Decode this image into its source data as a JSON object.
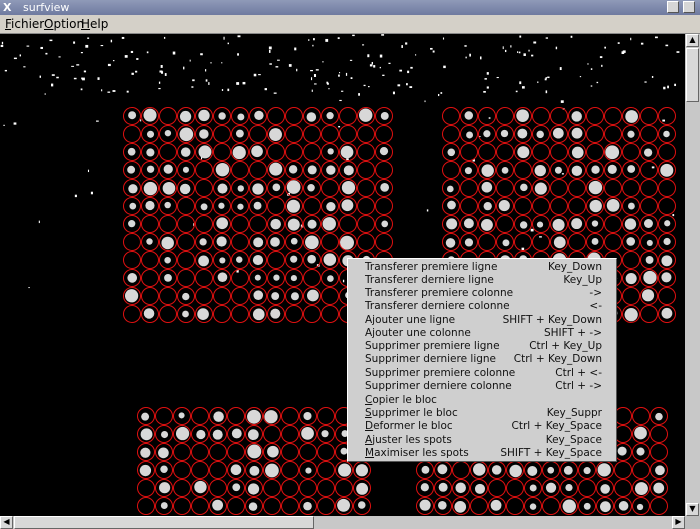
{
  "window": {
    "title": "surfview",
    "x_logo": "X"
  },
  "menubar": [
    {
      "label": "Fichier",
      "mnemonic": "F",
      "rest": "ichier"
    },
    {
      "label": "Option",
      "mnemonic": "O",
      "rest": "ption"
    },
    {
      "label": "Help",
      "mnemonic": "H",
      "rest": "elp"
    }
  ],
  "context_menu": [
    {
      "label": "Transferer premiere ligne",
      "shortcut": "Key_Down"
    },
    {
      "label": "Transferer derniere ligne",
      "shortcut": "Key_Up"
    },
    {
      "label": "Transferer premiere colonne",
      "shortcut": "->"
    },
    {
      "label": "Transferer derniere colonne",
      "shortcut": "<-"
    },
    {
      "label": "Ajouter une ligne",
      "shortcut": "SHIFT + Key_Down"
    },
    {
      "label": "Ajouter une colonne",
      "shortcut": "SHIFT + ->"
    },
    {
      "label": "Supprimer premiere ligne",
      "shortcut": "Ctrl + Key_Up"
    },
    {
      "label": "Supprimer derniere ligne",
      "shortcut": "Ctrl + Key_Down"
    },
    {
      "label": "Supprimer premiere colonne",
      "shortcut": "Ctrl + <-"
    },
    {
      "label": "Supprimer derniere colonne",
      "shortcut": "Ctrl + ->"
    },
    {
      "label": "Copier le bloc",
      "mnemonic": "C",
      "rest": "opier le bloc",
      "shortcut": ""
    },
    {
      "label": "Supprimer le bloc",
      "mnemonic": "S",
      "rest": "upprimer le bloc",
      "shortcut": "Key_Suppr"
    },
    {
      "label": "Deformer le bloc",
      "mnemonic": "D",
      "rest": "eformer le bloc",
      "shortcut": "Ctrl + Key_Space"
    },
    {
      "label": "Ajuster les spots",
      "mnemonic": "A",
      "rest": "juster les spots",
      "shortcut": "Key_Space"
    },
    {
      "label": "Maximiser les spots",
      "mnemonic": "M",
      "rest": "aximiser les spots",
      "shortcut": "SHIFT + Key_Space"
    }
  ],
  "colors": {
    "grid_circle": "#e01010",
    "spot": "#d8d8d8",
    "canvas": "#000000"
  }
}
